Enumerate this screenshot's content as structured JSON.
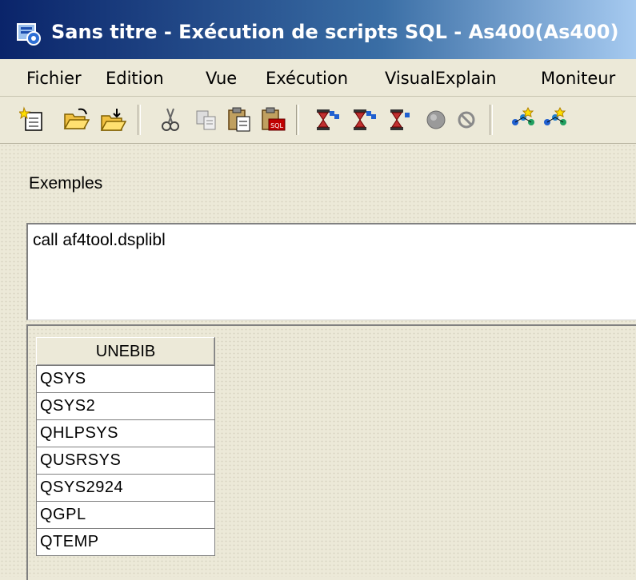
{
  "window": {
    "title": "Sans titre - Exécution de scripts SQL - As400(As400)",
    "icon": "database-query-icon"
  },
  "menubar": {
    "items": [
      "Fichier",
      "Edition",
      "Vue",
      "Exécution",
      "VisualExplain",
      "Moniteur"
    ]
  },
  "toolbar": {
    "buttons": [
      "new-icon",
      "open-icon",
      "save-icon",
      "cut-icon",
      "copy-icon",
      "paste-icon",
      "insert-sql-icon",
      "run-all-icon",
      "run-from-selection-icon",
      "run-selected-icon",
      "stop-icon",
      "cancel-icon",
      "visual-explain-icon",
      "visual-explain-run-icon"
    ]
  },
  "examples": {
    "label": "Exemples"
  },
  "editor": {
    "sql": "call af4tool.dsplibl"
  },
  "results": {
    "columns": [
      "UNEBIB"
    ],
    "rows": [
      [
        "QSYS"
      ],
      [
        "QSYS2"
      ],
      [
        "QHLPSYS"
      ],
      [
        "QUSRSYS"
      ],
      [
        "QSYS2924"
      ],
      [
        "QGPL"
      ],
      [
        "QTEMP"
      ]
    ]
  },
  "colors": {
    "title_gradient_start": "#0a246a",
    "title_gradient_end": "#a6caf0",
    "face": "#ece9d8"
  }
}
